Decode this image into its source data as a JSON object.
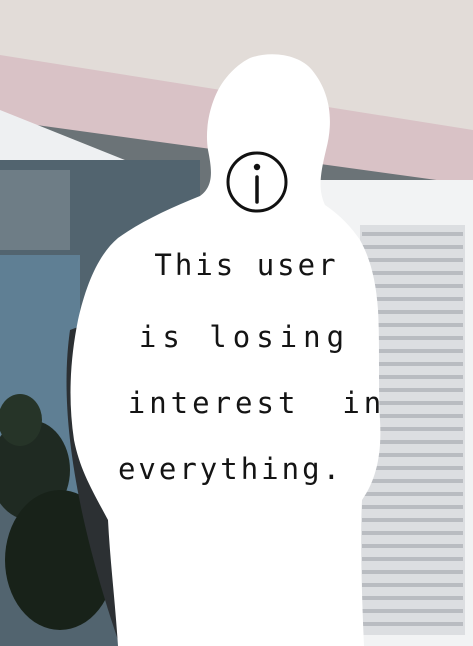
{
  "image": {
    "text_lines": [
      "This user",
      "is losing",
      "interest  in",
      "everything."
    ],
    "icon": "info-icon",
    "colors": {
      "ceiling": "#ded7d3",
      "cornice": "#d9c2c6",
      "wall_left": "#4b5d6a",
      "shutter": "#e6e7e9",
      "silhouette": "#ffffff",
      "text": "#141414"
    }
  }
}
